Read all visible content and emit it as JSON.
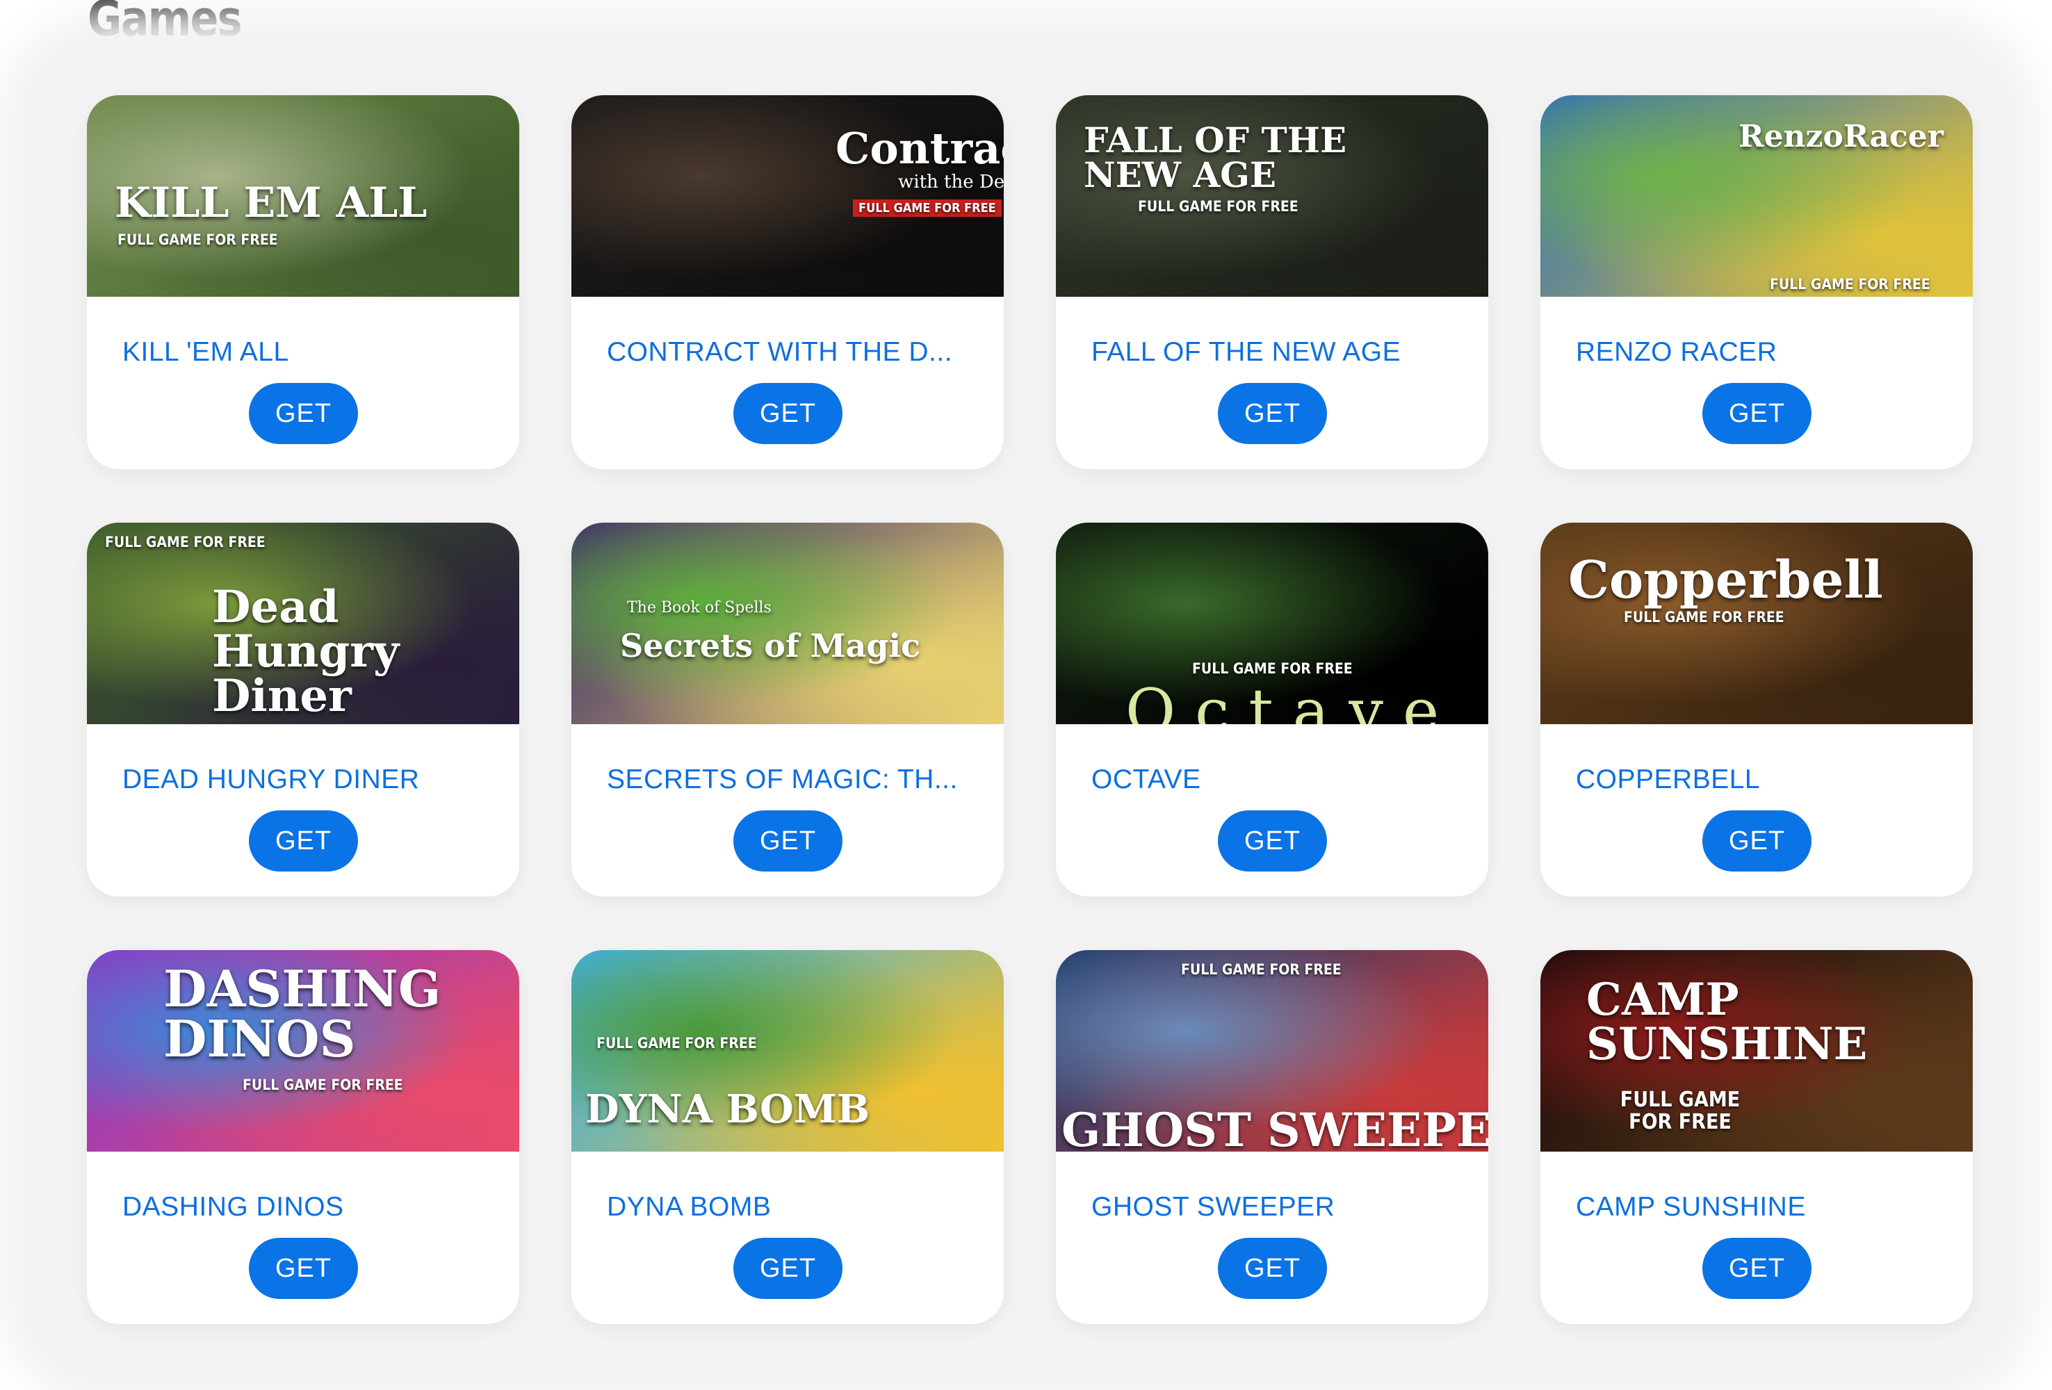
{
  "page": {
    "title": "Games"
  },
  "games": [
    {
      "name": "KILL 'EM ALL",
      "button": "GET",
      "thumbnail": {
        "title": "KILL EM ALL",
        "tag": "FULL GAME FOR FREE",
        "colors": [
          "#6d8a4a",
          "#a7b38a",
          "#3e5a2a"
        ]
      }
    },
    {
      "name": "CONTRACT WITH THE D...",
      "button": "GET",
      "thumbnail": {
        "title": "Contract",
        "subtitle": "with the Devil",
        "tag": "FULL GAME FOR FREE",
        "colors": [
          "#1c1a1a",
          "#4a3a2e",
          "#0e0d0d"
        ]
      }
    },
    {
      "name": "FALL OF THE NEW AGE",
      "button": "GET",
      "thumbnail": {
        "title": "FALL OF THE NEW AGE",
        "tag": "FULL GAME FOR FREE",
        "colors": [
          "#2b3226",
          "#4c5340",
          "#1b1f18"
        ]
      }
    },
    {
      "name": "RENZO RACER",
      "button": "GET",
      "thumbnail": {
        "title": "RenzoRacer",
        "tag": "FULL GAME FOR FREE",
        "colors": [
          "#2e6fb8",
          "#6fb24a",
          "#e1c23a"
        ]
      }
    },
    {
      "name": "DEAD HUNGRY DINER",
      "button": "GET",
      "thumbnail": {
        "title": "Dead Hungry Diner",
        "tag": "FULL GAME FOR FREE",
        "colors": [
          "#3a5a2a",
          "#7a9a3a",
          "#2a1e3a"
        ]
      }
    },
    {
      "name": "SECRETS OF MAGIC: TH...",
      "button": "GET",
      "thumbnail": {
        "title": "Secrets of Magic",
        "subtitle": "The Book of Spells",
        "colors": [
          "#3a2a6a",
          "#5cae3a",
          "#e8d070"
        ]
      }
    },
    {
      "name": "OCTAVE",
      "button": "GET",
      "thumbnail": {
        "title": "Octave",
        "tag": "FULL GAME FOR FREE",
        "colors": [
          "#0e1a0e",
          "#3a6a2a",
          "#000000"
        ]
      }
    },
    {
      "name": "COPPERBELL",
      "button": "GET",
      "thumbnail": {
        "title": "Copperbell",
        "tag": "FULL GAME FOR FREE",
        "colors": [
          "#5a3a1a",
          "#8a5a2a",
          "#3a2410"
        ]
      }
    },
    {
      "name": "DASHING DINOS",
      "button": "GET",
      "thumbnail": {
        "title": "DASHING DINOS",
        "tag": "FULL GAME FOR FREE",
        "colors": [
          "#8a3ac8",
          "#3a88d8",
          "#e84a6a"
        ]
      }
    },
    {
      "name": "DYNA BOMB",
      "button": "GET",
      "thumbnail": {
        "title": "DYNA BOMB",
        "tag": "FULL GAME FOR FREE",
        "colors": [
          "#3ab0e8",
          "#4a9a3a",
          "#f0c030"
        ]
      }
    },
    {
      "name": "GHOST SWEEPER",
      "button": "GET",
      "thumbnail": {
        "title": "GHOST SWEEPER",
        "tag": "FULL GAME FOR FREE",
        "colors": [
          "#1a3a6a",
          "#6a8ab8",
          "#c83a3a"
        ]
      }
    },
    {
      "name": "CAMP SUNSHINE",
      "button": "GET",
      "thumbnail": {
        "title": "CAMP SUNSHINE",
        "tag": "FULL GAME FOR FREE",
        "colors": [
          "#1a0a0a",
          "#8a1a1a",
          "#5a3a1a"
        ]
      }
    }
  ],
  "theme": {
    "accent": "#0a73e6",
    "name_color": "#0d6fe0",
    "panel_bg": "#f3f3f4",
    "card_bg": "#ffffff"
  }
}
